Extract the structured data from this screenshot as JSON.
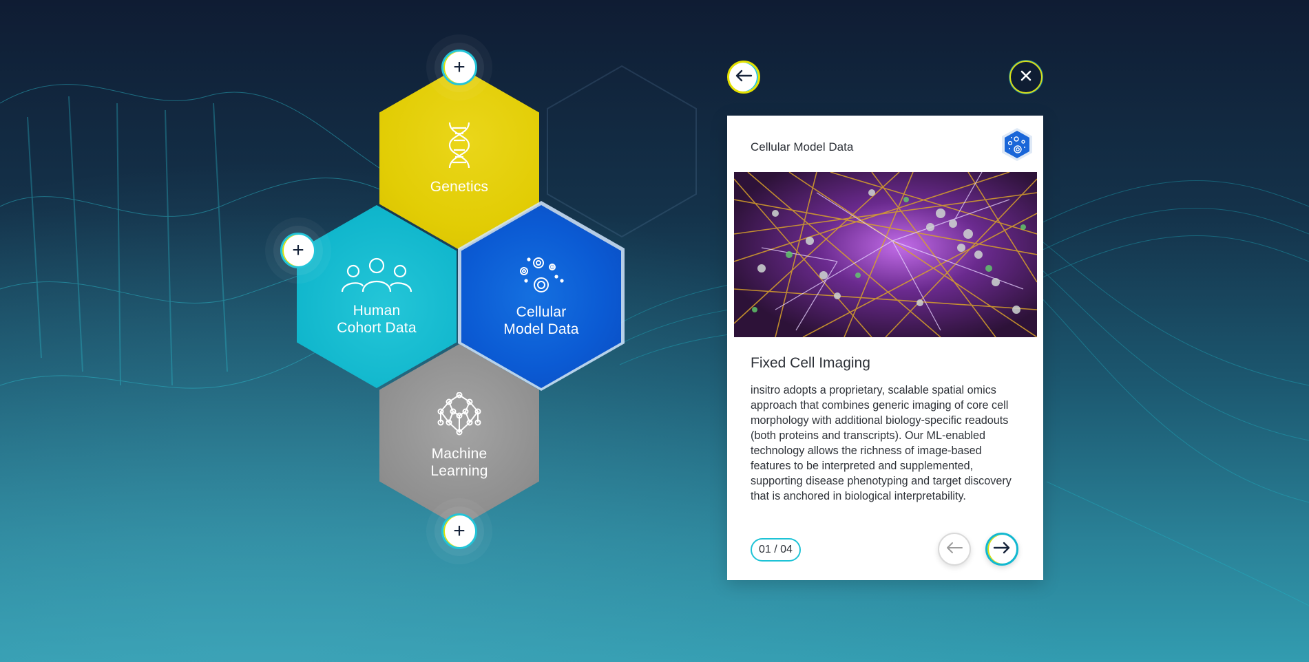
{
  "background": {
    "dna_color": "#2cc4d4",
    "wave_color": "#1ec0d0"
  },
  "hexes": {
    "genetics": {
      "label": "Genetics",
      "color": "#e2cd05",
      "icon": "dna-icon"
    },
    "human": {
      "label": "Human\nCohort Data",
      "color": "#10b6cc",
      "icon": "people-icon"
    },
    "cellular": {
      "label": "Cellular\nModel Data",
      "color": "#0b5bd4",
      "icon": "cells-icon"
    },
    "ml": {
      "label": "Machine\nLearning",
      "color": "#8e8e8e",
      "icon": "neural-network-icon"
    }
  },
  "plus_buttons": {
    "symbol": "+"
  },
  "top_nav": {
    "back_icon": "arrow-left-icon",
    "close_icon": "close-icon"
  },
  "card": {
    "category": "Cellular Model Data",
    "category_icon": "cells-hex-icon",
    "heading": "Fixed Cell Imaging",
    "body": "insitro adopts a proprietary, scalable spatial omics approach that combines generic imaging of core cell morphology with additional biology-specific readouts (both proteins and transcripts). Our ML-enabled technology allows the richness of image-based features to be interpreted and supplemented, supporting disease phenotyping and target discovery that is anchored in biological interpretability.",
    "pager": "01 / 04",
    "prev_icon": "arrow-left-icon",
    "next_icon": "arrow-right-icon",
    "image_alt": "microscopy-image"
  }
}
